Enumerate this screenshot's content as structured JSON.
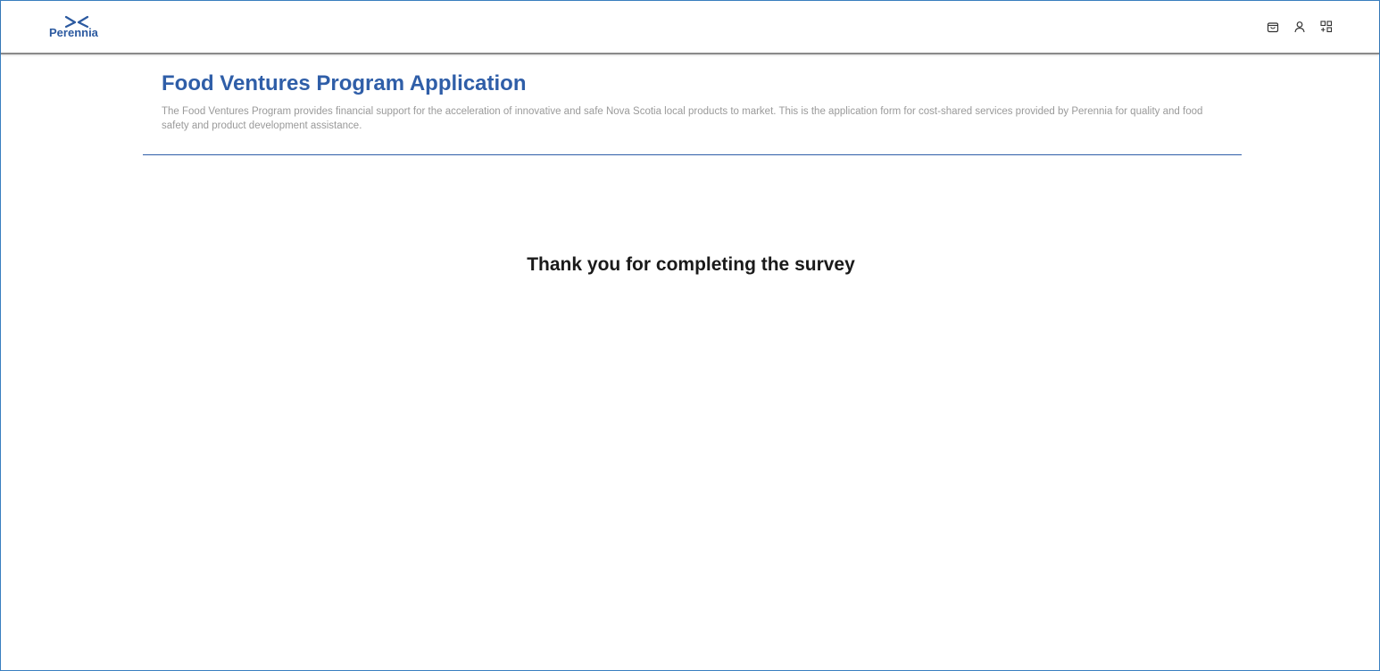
{
  "header": {
    "logo_text": "Perennia",
    "icons": [
      "shopping-bag-icon",
      "user-icon",
      "apps-grid-icon"
    ]
  },
  "main": {
    "title": "Food Ventures Program Application",
    "description": "The Food Ventures Program provides financial support for the acceleration of innovative and safe Nova Scotia local products to market. This is the application form for cost-shared services provided by Perennia for quality and food safety and product development assistance.",
    "completion_message": "Thank you for completing the survey"
  },
  "colors": {
    "brand_blue": "#2f5ea8",
    "frame_border": "#3a7fc0",
    "description_gray": "#9a9a9a"
  }
}
